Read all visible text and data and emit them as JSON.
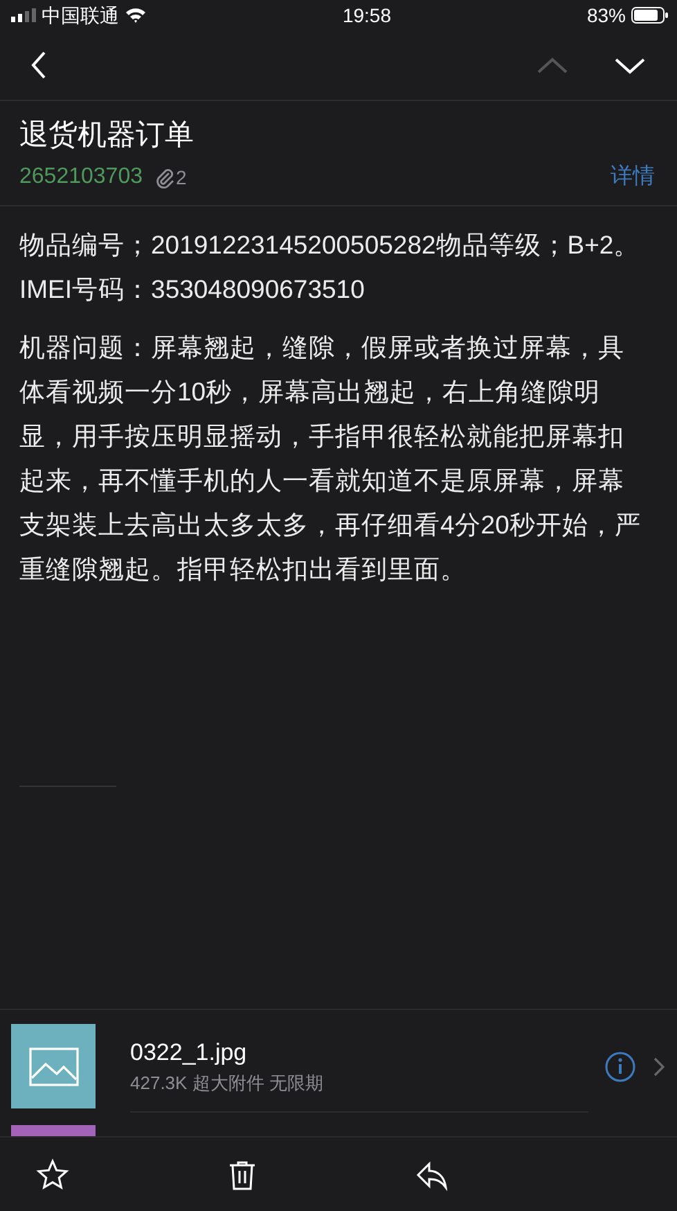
{
  "status_bar": {
    "carrier": "中国联通",
    "time": "19:58",
    "battery": "83%"
  },
  "nav": {
    "prev": {
      "disabled": true
    },
    "next": {
      "disabled": false
    }
  },
  "mail": {
    "subject": "退货机器订单",
    "sender": "2652103703",
    "attachment_count": "2",
    "details_link": "详情"
  },
  "body": [
    "物品编号；20191223145200505282物品等级；B+2。IMEI号码：353048090673510",
    "机器问题：屏幕翘起，缝隙，假屏或者换过屏幕，具体看视频一分10秒，屏幕高出翘起，右上角缝隙明显，用手按压明显摇动，手指甲很轻松就能把屏幕扣起来，再不懂手机的人一看就知道不是原屏幕，屏幕支架装上去高出太多太多，再仔细看4分20秒开始，严重缝隙翘起。指甲轻松扣出看到里面。"
  ],
  "attachments": [
    {
      "name": "0322_1.jpg",
      "meta": "427.3K 超大附件 无限期",
      "color": "#6db1bf"
    },
    {
      "color": "#a363b9"
    }
  ],
  "toolbar": [
    {
      "kind": "star"
    },
    {
      "kind": "trash"
    },
    {
      "kind": "reply"
    }
  ]
}
